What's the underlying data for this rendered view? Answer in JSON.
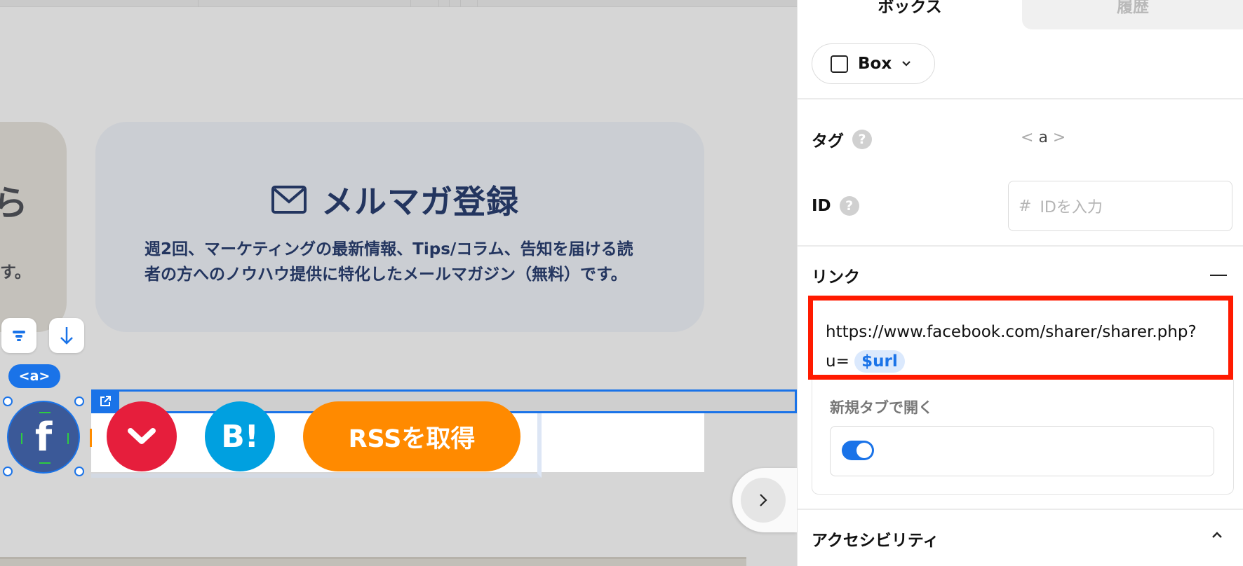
{
  "canvas": {
    "left_card": {
      "glyph": "ら",
      "tail": "す。"
    },
    "mail_card": {
      "icon": "mail-icon",
      "title": "メルマガ登録",
      "desc_line1": "週2回、マーケティングの最新情報、Tips/コラム、告知を届ける読",
      "desc_line2": "者の方へのノウハウ提供に特化したメールマガジン（無料）です。"
    },
    "element_tag": "<a>",
    "share_buttons": {
      "facebook": "f",
      "hatena": "B!",
      "rss": "RSSを取得"
    }
  },
  "panel": {
    "tabs": [
      "ボックス",
      "履歴"
    ],
    "element_type": "Box",
    "tag": {
      "label": "タグ",
      "value": "a"
    },
    "id": {
      "label": "ID",
      "prefix": "#",
      "placeholder": "IDを入力"
    },
    "link": {
      "label": "リンク",
      "url_line1": "https://www.facebook.com/sharer/sharer.php?",
      "url_prefix2": "u=",
      "url_var": "$url"
    },
    "new_tab": {
      "label": "新規タブで開く",
      "enabled": true
    },
    "accessibility": {
      "label": "アクセシビリティ"
    }
  },
  "colors": {
    "accent": "#1a73e8",
    "highlight": "#ff1a00",
    "facebook": "#3b5998",
    "pocket": "#e61e3c",
    "hatena": "#00a0e0",
    "rss": "#ff8a00",
    "mail_text": "#23355f"
  }
}
